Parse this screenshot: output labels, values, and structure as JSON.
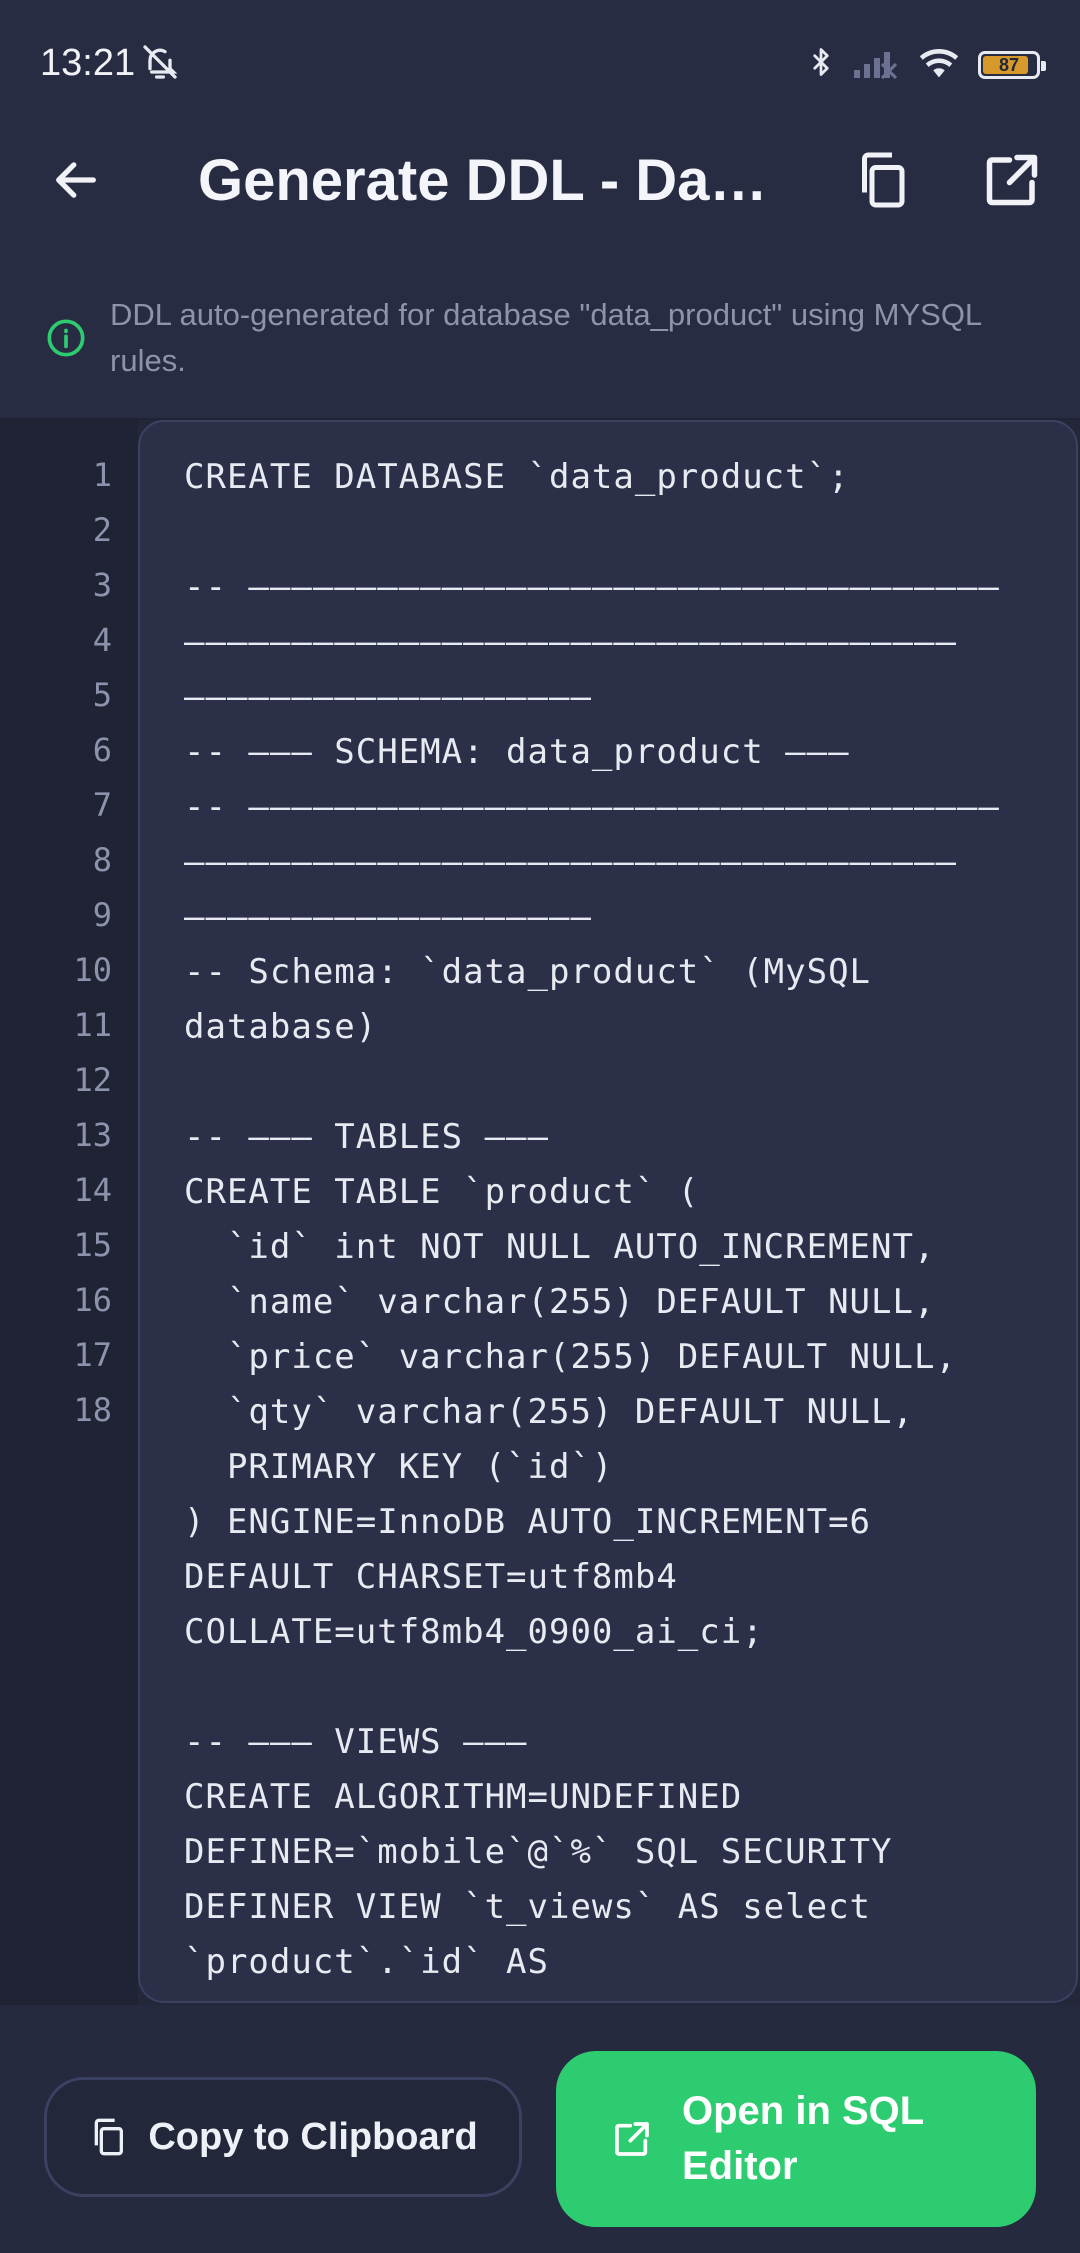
{
  "status_bar": {
    "time": "13:21",
    "battery_level": "87",
    "battery_fraction": 0.87,
    "icons": [
      "bell-off-icon",
      "bluetooth-icon",
      "signal-icon",
      "wifi-icon",
      "battery-icon"
    ]
  },
  "app_bar": {
    "title": "Generate DDL - Database \"data_product\"",
    "back_icon": "arrow-left-icon",
    "copy_icon": "copy-icon",
    "open_icon": "open-external-icon"
  },
  "info": {
    "message": "DDL auto-generated for database \"data_product\" using MYSQL rules.",
    "icon": "info-circle-icon"
  },
  "editor": {
    "line_numbers": [
      "1",
      "2",
      "3",
      "4",
      "5",
      "6",
      "7",
      "8",
      "9",
      "10",
      "11",
      "12",
      "13",
      "14",
      "15",
      "16",
      "17",
      "18"
    ],
    "code": "CREATE DATABASE `data_product`;\n\n-- ———————————————————————————————————\n————————————————————————————————————\n———————————————————\n-- ——— SCHEMA: data_product ———\n-- ———————————————————————————————————\n————————————————————————————————————\n———————————————————\n-- Schema: `data_product` (MySQL\ndatabase)\n\n-- ——— TABLES ———\nCREATE TABLE `product` (\n  `id` int NOT NULL AUTO_INCREMENT,\n  `name` varchar(255) DEFAULT NULL,\n  `price` varchar(255) DEFAULT NULL,\n  `qty` varchar(255) DEFAULT NULL,\n  PRIMARY KEY (`id`)\n) ENGINE=InnoDB AUTO_INCREMENT=6\nDEFAULT CHARSET=utf8mb4\nCOLLATE=utf8mb4_0900_ai_ci;\n\n-- ——— VIEWS ———\nCREATE ALGORITHM=UNDEFINED\nDEFINER=`mobile`@`%` SQL SECURITY\nDEFINER VIEW `t_views` AS select\n`product`.`id` AS"
  },
  "actions": {
    "copy_label": "Copy to Clipboard",
    "open_label": "Open in SQL Editor",
    "copy_icon": "copy-icon",
    "open_icon": "open-external-icon"
  },
  "colors": {
    "background": "#272c42",
    "accent_green": "#2ecc71",
    "battery": "#d79a2a"
  }
}
